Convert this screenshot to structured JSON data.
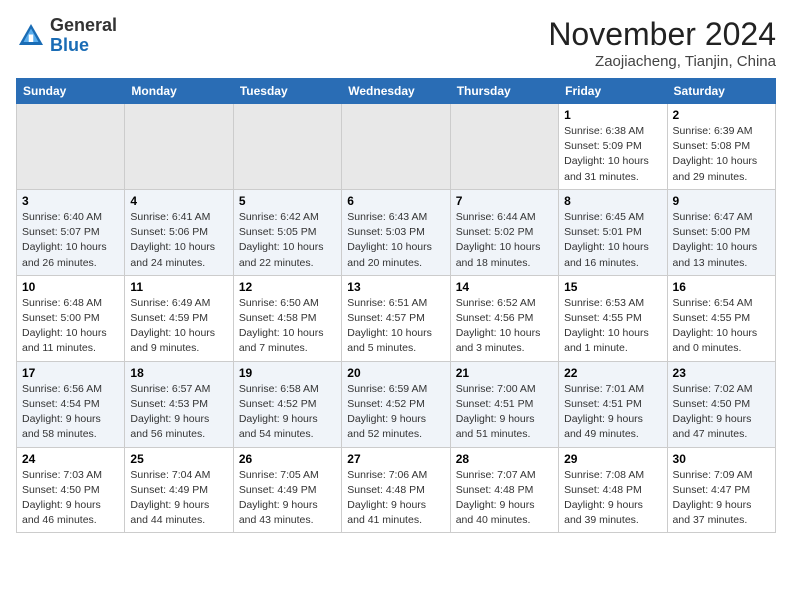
{
  "header": {
    "logo_line1": "General",
    "logo_line2": "Blue",
    "month": "November 2024",
    "location": "Zaojiacheng, Tianjin, China"
  },
  "weekdays": [
    "Sunday",
    "Monday",
    "Tuesday",
    "Wednesday",
    "Thursday",
    "Friday",
    "Saturday"
  ],
  "weeks": [
    [
      {
        "day": "",
        "info": ""
      },
      {
        "day": "",
        "info": ""
      },
      {
        "day": "",
        "info": ""
      },
      {
        "day": "",
        "info": ""
      },
      {
        "day": "",
        "info": ""
      },
      {
        "day": "1",
        "info": "Sunrise: 6:38 AM\nSunset: 5:09 PM\nDaylight: 10 hours\nand 31 minutes."
      },
      {
        "day": "2",
        "info": "Sunrise: 6:39 AM\nSunset: 5:08 PM\nDaylight: 10 hours\nand 29 minutes."
      }
    ],
    [
      {
        "day": "3",
        "info": "Sunrise: 6:40 AM\nSunset: 5:07 PM\nDaylight: 10 hours\nand 26 minutes."
      },
      {
        "day": "4",
        "info": "Sunrise: 6:41 AM\nSunset: 5:06 PM\nDaylight: 10 hours\nand 24 minutes."
      },
      {
        "day": "5",
        "info": "Sunrise: 6:42 AM\nSunset: 5:05 PM\nDaylight: 10 hours\nand 22 minutes."
      },
      {
        "day": "6",
        "info": "Sunrise: 6:43 AM\nSunset: 5:03 PM\nDaylight: 10 hours\nand 20 minutes."
      },
      {
        "day": "7",
        "info": "Sunrise: 6:44 AM\nSunset: 5:02 PM\nDaylight: 10 hours\nand 18 minutes."
      },
      {
        "day": "8",
        "info": "Sunrise: 6:45 AM\nSunset: 5:01 PM\nDaylight: 10 hours\nand 16 minutes."
      },
      {
        "day": "9",
        "info": "Sunrise: 6:47 AM\nSunset: 5:00 PM\nDaylight: 10 hours\nand 13 minutes."
      }
    ],
    [
      {
        "day": "10",
        "info": "Sunrise: 6:48 AM\nSunset: 5:00 PM\nDaylight: 10 hours\nand 11 minutes."
      },
      {
        "day": "11",
        "info": "Sunrise: 6:49 AM\nSunset: 4:59 PM\nDaylight: 10 hours\nand 9 minutes."
      },
      {
        "day": "12",
        "info": "Sunrise: 6:50 AM\nSunset: 4:58 PM\nDaylight: 10 hours\nand 7 minutes."
      },
      {
        "day": "13",
        "info": "Sunrise: 6:51 AM\nSunset: 4:57 PM\nDaylight: 10 hours\nand 5 minutes."
      },
      {
        "day": "14",
        "info": "Sunrise: 6:52 AM\nSunset: 4:56 PM\nDaylight: 10 hours\nand 3 minutes."
      },
      {
        "day": "15",
        "info": "Sunrise: 6:53 AM\nSunset: 4:55 PM\nDaylight: 10 hours\nand 1 minute."
      },
      {
        "day": "16",
        "info": "Sunrise: 6:54 AM\nSunset: 4:55 PM\nDaylight: 10 hours\nand 0 minutes."
      }
    ],
    [
      {
        "day": "17",
        "info": "Sunrise: 6:56 AM\nSunset: 4:54 PM\nDaylight: 9 hours\nand 58 minutes."
      },
      {
        "day": "18",
        "info": "Sunrise: 6:57 AM\nSunset: 4:53 PM\nDaylight: 9 hours\nand 56 minutes."
      },
      {
        "day": "19",
        "info": "Sunrise: 6:58 AM\nSunset: 4:52 PM\nDaylight: 9 hours\nand 54 minutes."
      },
      {
        "day": "20",
        "info": "Sunrise: 6:59 AM\nSunset: 4:52 PM\nDaylight: 9 hours\nand 52 minutes."
      },
      {
        "day": "21",
        "info": "Sunrise: 7:00 AM\nSunset: 4:51 PM\nDaylight: 9 hours\nand 51 minutes."
      },
      {
        "day": "22",
        "info": "Sunrise: 7:01 AM\nSunset: 4:51 PM\nDaylight: 9 hours\nand 49 minutes."
      },
      {
        "day": "23",
        "info": "Sunrise: 7:02 AM\nSunset: 4:50 PM\nDaylight: 9 hours\nand 47 minutes."
      }
    ],
    [
      {
        "day": "24",
        "info": "Sunrise: 7:03 AM\nSunset: 4:50 PM\nDaylight: 9 hours\nand 46 minutes."
      },
      {
        "day": "25",
        "info": "Sunrise: 7:04 AM\nSunset: 4:49 PM\nDaylight: 9 hours\nand 44 minutes."
      },
      {
        "day": "26",
        "info": "Sunrise: 7:05 AM\nSunset: 4:49 PM\nDaylight: 9 hours\nand 43 minutes."
      },
      {
        "day": "27",
        "info": "Sunrise: 7:06 AM\nSunset: 4:48 PM\nDaylight: 9 hours\nand 41 minutes."
      },
      {
        "day": "28",
        "info": "Sunrise: 7:07 AM\nSunset: 4:48 PM\nDaylight: 9 hours\nand 40 minutes."
      },
      {
        "day": "29",
        "info": "Sunrise: 7:08 AM\nSunset: 4:48 PM\nDaylight: 9 hours\nand 39 minutes."
      },
      {
        "day": "30",
        "info": "Sunrise: 7:09 AM\nSunset: 4:47 PM\nDaylight: 9 hours\nand 37 minutes."
      }
    ]
  ]
}
